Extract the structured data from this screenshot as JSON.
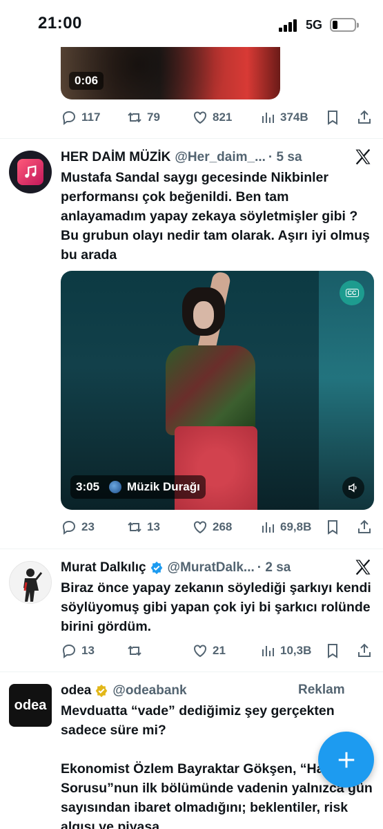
{
  "status_bar": {
    "time": "21:00",
    "network": "5G"
  },
  "top_tweet": {
    "video_duration": "0:06",
    "replies": "117",
    "retweets": "79",
    "likes": "821",
    "views": "374B"
  },
  "tweet1": {
    "display_name": "HER DAİM MÜZİK",
    "handle": "@Her_daim_...",
    "time": "· 5 sa",
    "text": "Mustafa Sandal saygı gecesinde Nikbinler performansı çok beğenildi. Ben tam anlayamadım yapay zekaya söyletmişler gibi ? Bu grubun olayı nedir tam olarak. Aşırı iyi olmuş bu arada",
    "video_duration": "3:05",
    "video_source": "Müzik Durağı",
    "cc_label": "CC",
    "replies": "23",
    "retweets": "13",
    "likes": "268",
    "views": "69,8B"
  },
  "tweet2": {
    "display_name": "Murat Dalkılıç",
    "handle": "@MuratDalk...",
    "time": "· 2 sa",
    "text": "Biraz önce yapay zekanın söylediği şarkıyı kendi söylüyomuş gibi yapan çok iyi bi şarkıcı rolünde birini gördüm.",
    "replies": "13",
    "retweets": "",
    "likes": "21",
    "views": "10,3B"
  },
  "ad_tweet": {
    "display_name": "odea",
    "handle": "@odeabank",
    "ad_label": "Reklam",
    "logo_text": "odea",
    "text_1": "Mevduatta “vade” dediğimiz şey gerçekten sadece süre mi?",
    "text_2": "Ekonomist Özlem Bayraktar Gökşen, “Haftanın Sorusu”nun ilk bölümünde vadenin yalnızca gün sayısından ibaret olmadığını; beklentiler, risk algısı ve piyasa"
  },
  "colors": {
    "accent": "#1d9bf0",
    "text": "#0f1419",
    "muted": "#536471",
    "verified_gold": "#e2b719"
  },
  "icons": [
    "reply-icon",
    "retweet-icon",
    "like-icon",
    "views-icon",
    "bookmark-icon",
    "share-icon",
    "x-logo-icon",
    "verified-gold-icon",
    "verified-blue-icon",
    "music-note-icon",
    "plus-icon"
  ]
}
